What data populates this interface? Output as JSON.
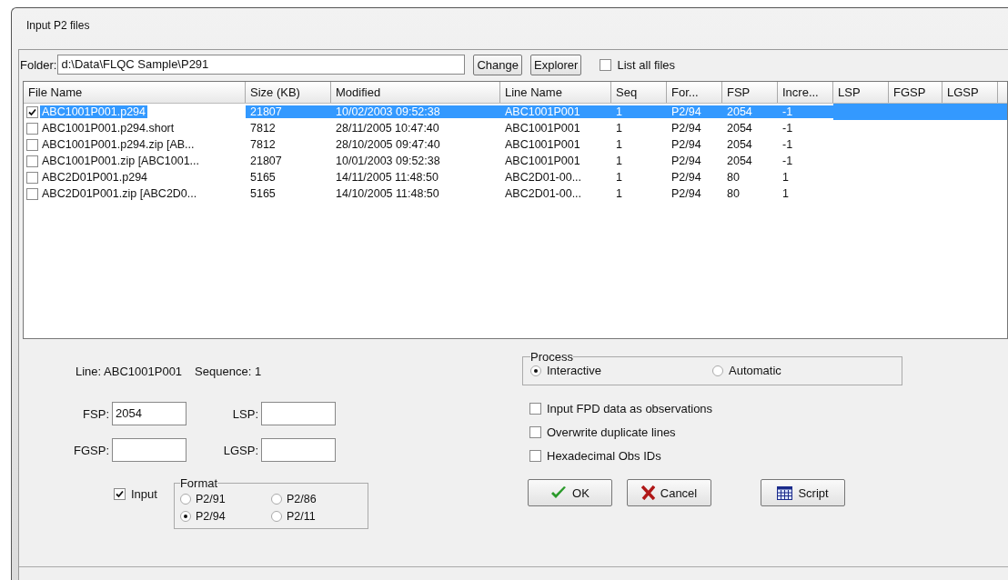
{
  "window": {
    "title": "Input P2 files"
  },
  "folder": {
    "label": "Folder:",
    "value": "d:\\Data\\FLQC Sample\\P291"
  },
  "folder_buttons": [
    "Change",
    "Explorer"
  ],
  "list_all": {
    "label": "List all files",
    "checked": false
  },
  "table": {
    "columns": [
      "File Name",
      "Size (KB)",
      "Modified",
      "Line Name",
      "Seq",
      "For...",
      "FSP",
      "Incre...",
      "LSP",
      "FGSP",
      "LGSP"
    ],
    "rows": [
      {
        "selected": true,
        "checked": true,
        "cells": [
          "ABC1001P001.p294",
          "21807",
          "10/02/2003 09:52:38",
          "ABC1001P001",
          "1",
          "P2/94",
          "2054",
          "-1"
        ]
      },
      {
        "selected": false,
        "checked": false,
        "cells": [
          "ABC1001P001.p294.short",
          "7812",
          "28/11/2005 10:47:40",
          "ABC1001P001",
          "1",
          "P2/94",
          "2054",
          "-1"
        ]
      },
      {
        "selected": false,
        "checked": false,
        "cells": [
          "ABC1001P001.p294.zip [AB...",
          "7812",
          "28/10/2005 09:47:40",
          "ABC1001P001",
          "1",
          "P2/94",
          "2054",
          "-1"
        ]
      },
      {
        "selected": false,
        "checked": false,
        "cells": [
          "ABC1001P001.zip [ABC1001...",
          "21807",
          "10/01/2003 09:52:38",
          "ABC1001P001",
          "1",
          "P2/94",
          "2054",
          "-1"
        ]
      },
      {
        "selected": false,
        "checked": false,
        "cells": [
          "ABC2D01P001.p294",
          "5165",
          "14/11/2005 11:48:50",
          "ABC2D01-00...",
          "1",
          "P2/94",
          "80",
          "1"
        ]
      },
      {
        "selected": false,
        "checked": false,
        "cells": [
          "ABC2D01P001.zip [ABC2D0...",
          "5165",
          "14/10/2005 11:48:50",
          "ABC2D01-00...",
          "1",
          "P2/94",
          "80",
          "1"
        ]
      }
    ]
  },
  "line_info": {
    "line": "Line: ABC1001P001",
    "sequence": "Sequence: 1"
  },
  "fields": [
    {
      "label": "FSP:",
      "value": "2054"
    },
    {
      "label": "LSP:"
    },
    {
      "label": "FGSP:"
    },
    {
      "label": "LGSP:"
    }
  ],
  "input": {
    "label": "Input",
    "checked": true
  },
  "format": {
    "title": "Format",
    "options": [
      {
        "label": "P2/91",
        "selected": false
      },
      {
        "label": "P2/86",
        "selected": false
      },
      {
        "label": "P2/94",
        "selected": true
      },
      {
        "label": "P2/11",
        "selected": false
      }
    ]
  },
  "process": {
    "title": "Process",
    "options": [
      {
        "label": "Interactive",
        "selected": true
      },
      {
        "label": "Automatic",
        "selected": false
      }
    ]
  },
  "options": [
    {
      "label": "Input FPD data as observations",
      "checked": false
    },
    {
      "label": "Overwrite duplicate lines",
      "checked": false
    },
    {
      "label": "Hexadecimal Obs IDs",
      "checked": false
    }
  ],
  "actions": [
    {
      "kind": "ok",
      "label": "OK"
    },
    {
      "kind": "cancel",
      "label": "Cancel"
    },
    {
      "kind": "script",
      "label": "Script"
    }
  ]
}
